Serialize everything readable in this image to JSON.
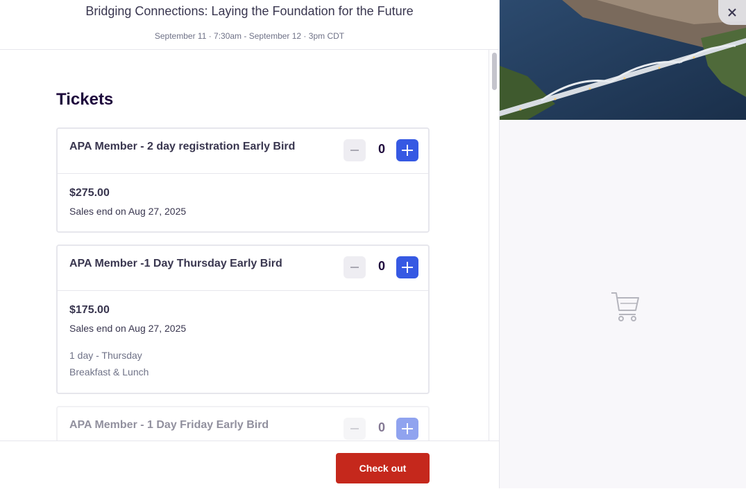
{
  "event": {
    "title": "Bridging Connections: Laying the Foundation for the Future",
    "dates": "September 11 · 7:30am - September 12 · 3pm CDT"
  },
  "tickets_section": {
    "title": "Tickets",
    "tickets": [
      {
        "name": "APA Member - 2 day registration Early Bird",
        "quantity": "0",
        "price": "$275.00",
        "sales_end": "Sales end on Aug 27, 2025",
        "details": []
      },
      {
        "name": "APA Member -1 Day Thursday Early Bird",
        "quantity": "0",
        "price": "$175.00",
        "sales_end": "Sales end on Aug 27, 2025",
        "details": [
          "1 day - Thursday",
          "Breakfast & Lunch"
        ]
      },
      {
        "name": "APA Member - 1 Day Friday Early Bird",
        "quantity": "0"
      }
    ]
  },
  "footer": {
    "checkout_label": "Check out"
  },
  "icons": {
    "close": "close-icon",
    "cart": "cart-icon",
    "minus": "minus-icon",
    "plus": "plus-icon"
  },
  "colors": {
    "accent_blue": "#3659e3",
    "checkout_red": "#c5281c",
    "title_text": "#1e0a3c"
  }
}
